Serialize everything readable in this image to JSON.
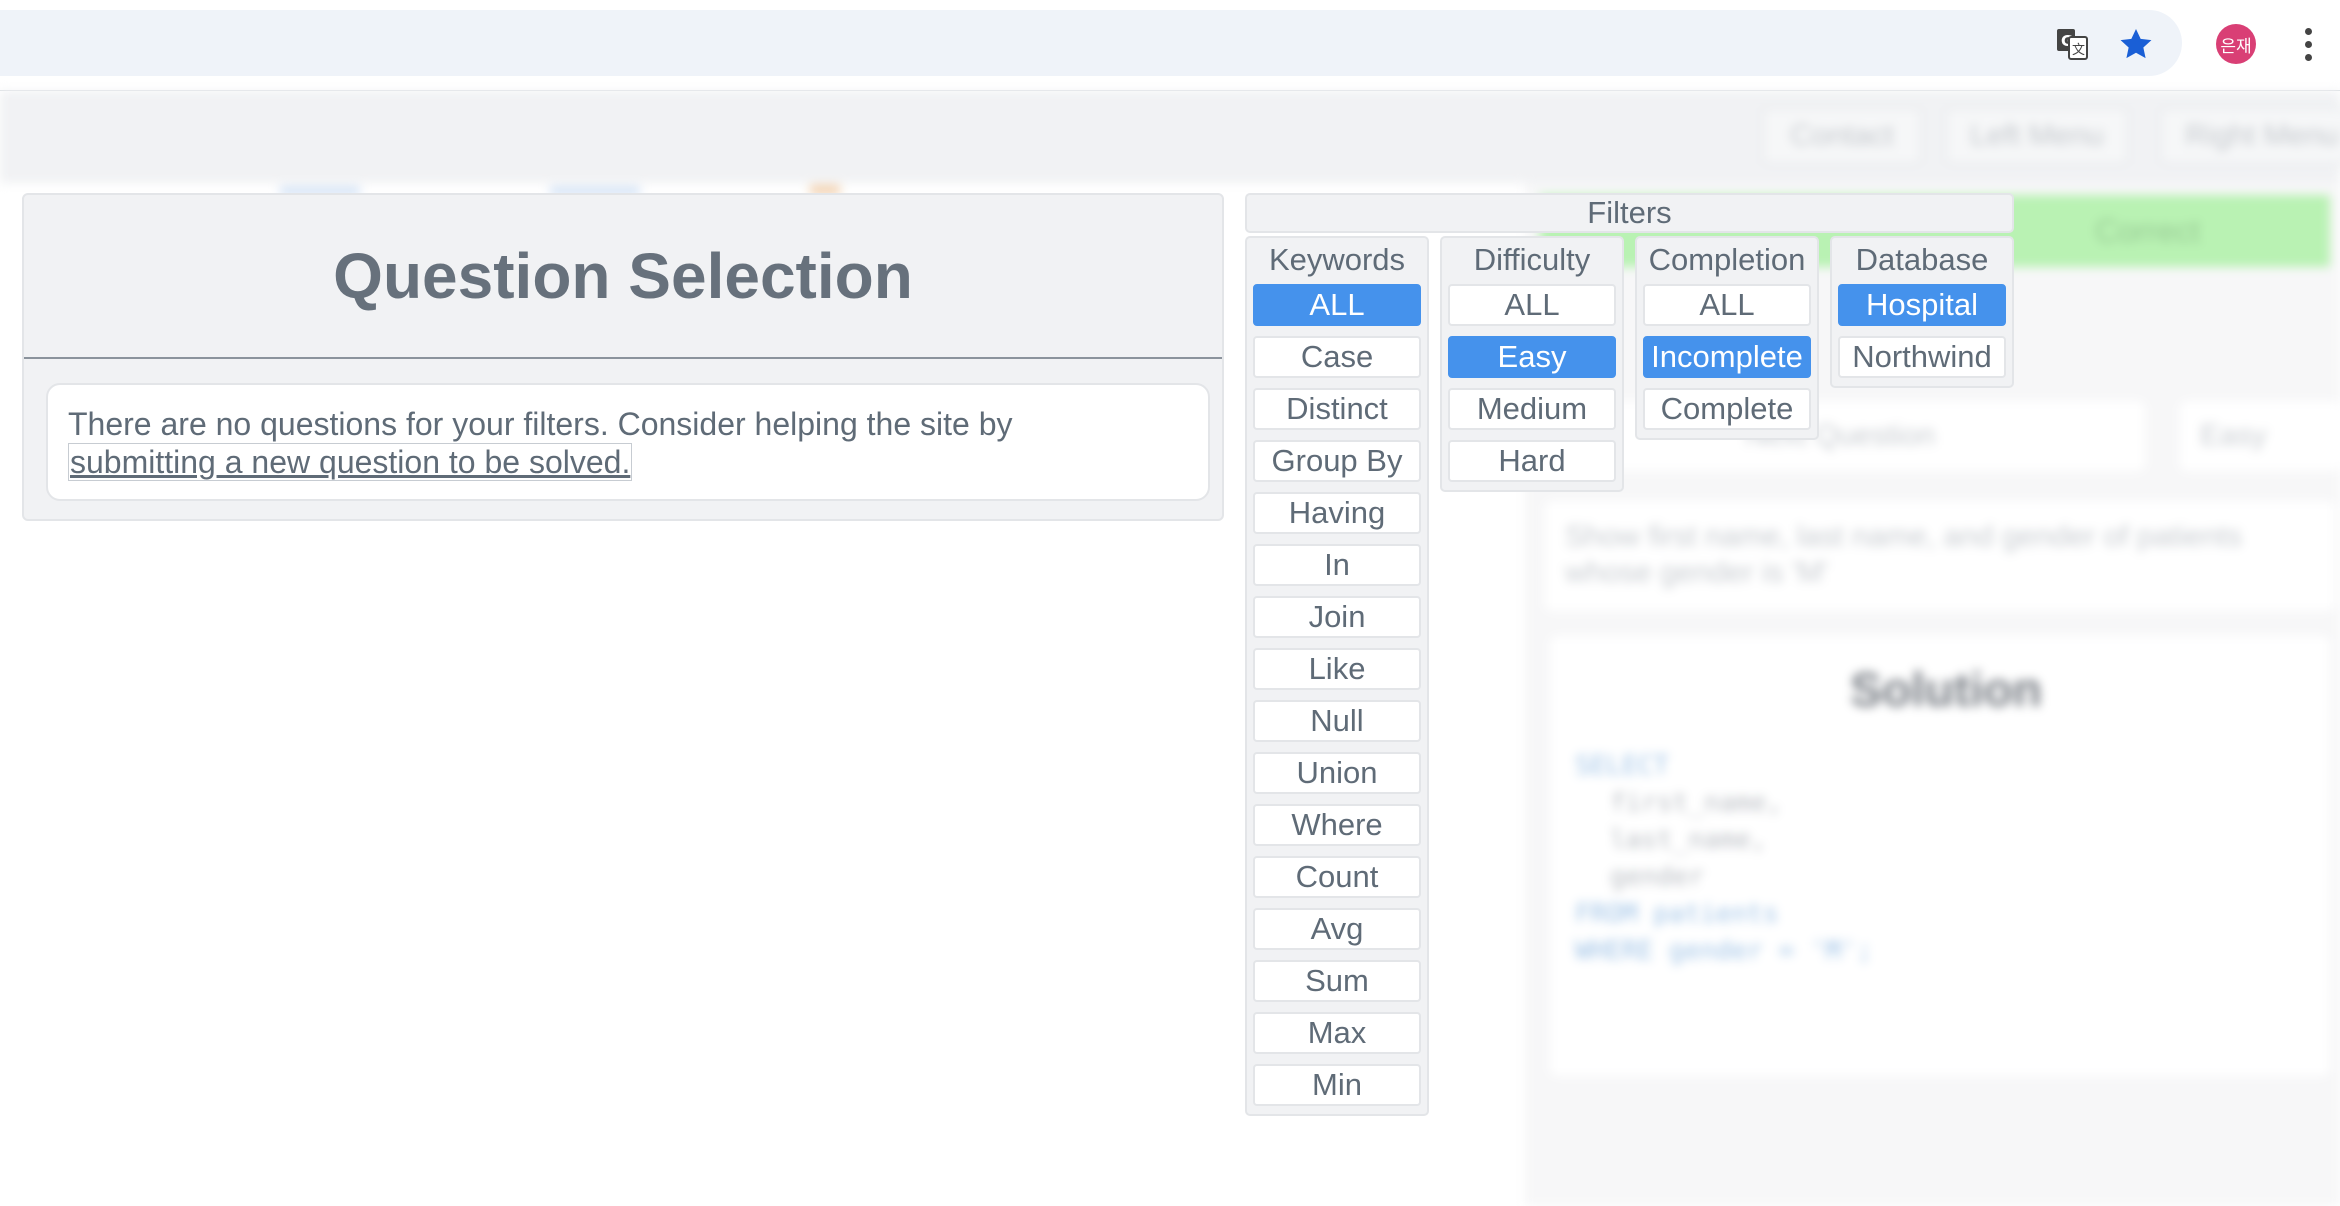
{
  "browser": {
    "translate_icon": "google-translate-icon",
    "bookmark_icon": "star-icon",
    "avatar_text": "은재",
    "menu_icon": "kebab-menu-icon"
  },
  "background": {
    "nav": [
      "Contact",
      "Left Menu",
      "Right Menu"
    ],
    "status": "Correct",
    "question_nav": "Next Question",
    "question_nav_side": "Easy",
    "question_text": "Show first name, last name, and gender of patients whose gender is 'M'",
    "solution_title": "Solution",
    "code": [
      "SELECT",
      "first_name,",
      "last_name,",
      "gender",
      "FROM patients",
      "WHERE gender = 'M';"
    ]
  },
  "question_selection": {
    "title": "Question Selection",
    "message": "There are no questions for your filters. Consider helping the site by",
    "link": "submitting a new question to be solved."
  },
  "filters": {
    "title": "Filters",
    "keywords": {
      "title": "Keywords",
      "options": [
        "ALL",
        "Case",
        "Distinct",
        "Group By",
        "Having",
        "In",
        "Join",
        "Like",
        "Null",
        "Union",
        "Where",
        "Count",
        "Avg",
        "Sum",
        "Max",
        "Min"
      ],
      "active": "ALL"
    },
    "difficulty": {
      "title": "Difficulty",
      "options": [
        "ALL",
        "Easy",
        "Medium",
        "Hard"
      ],
      "active": "Easy"
    },
    "completion": {
      "title": "Completion",
      "options": [
        "ALL",
        "Incomplete",
        "Complete"
      ],
      "active": "Incomplete"
    },
    "database": {
      "title": "Database",
      "options": [
        "Hospital",
        "Northwind"
      ],
      "active": "Hospital"
    }
  },
  "colors": {
    "accent": "#4592ec",
    "panel": "#f1f2f4",
    "text": "#5f6b77"
  }
}
